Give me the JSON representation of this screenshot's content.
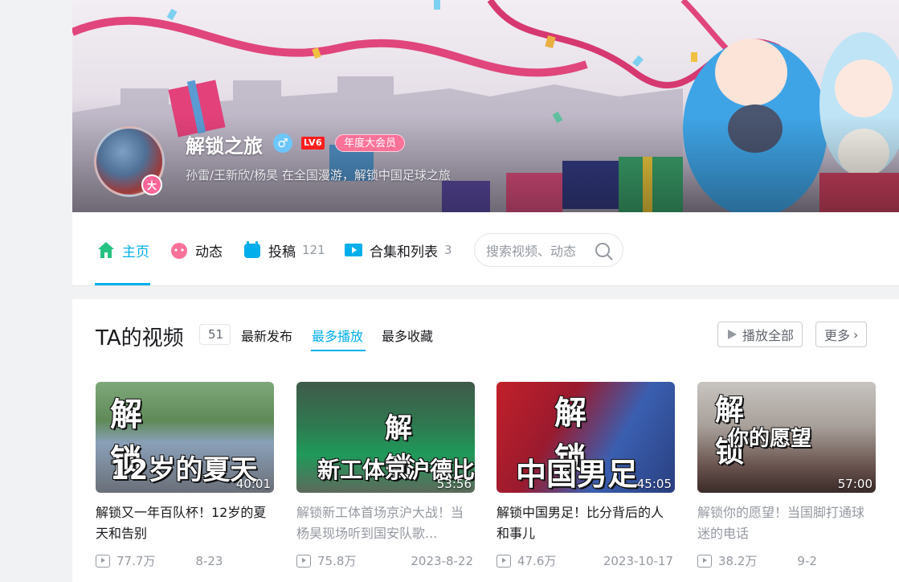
{
  "profile": {
    "name": "解锁之旅",
    "level": "LV6",
    "vip": "年度大会员",
    "avatar_badge": "大",
    "sign": "孙雷/王新欣/杨昊 在全国漫游，解锁中国足球之旅"
  },
  "nav": {
    "items": [
      {
        "label": "主页",
        "count": "",
        "icon": "home-icon"
      },
      {
        "label": "动态",
        "count": "",
        "icon": "dynamic-icon"
      },
      {
        "label": "投稿",
        "count": "121",
        "icon": "upload-icon"
      },
      {
        "label": "合集和列表",
        "count": "3",
        "icon": "collection-icon"
      }
    ],
    "search_placeholder": "搜索视频、动态"
  },
  "videos_section": {
    "title": "TA的视频",
    "count": "51",
    "sort_tabs": [
      "最新发布",
      "最多播放",
      "最多收藏"
    ],
    "active_sort": "最多播放",
    "play_all": "播放全部",
    "more": "更多"
  },
  "videos": [
    {
      "title": "解锁又一年百队杯！12岁的夏天和告别",
      "duration": "40:01",
      "views": "77.7万",
      "date": "8-23",
      "thumb_text_1": "解 锁",
      "thumb_text_2": "12岁的夏天"
    },
    {
      "title": "解锁新工体首场京沪大战！当杨昊现场听到国安队歌...",
      "duration": "53:56",
      "views": "75.8万",
      "date": "2023-8-22",
      "thumb_text_1": "解 锁",
      "thumb_text_2": "新工体京沪德比"
    },
    {
      "title": "解锁中国男足！比分背后的人和事儿",
      "duration": "45:05",
      "views": "47.6万",
      "date": "2023-10-17",
      "thumb_text_1": "解 锁",
      "thumb_text_2": "中国男足"
    },
    {
      "title": "解锁你的愿望！当国脚打通球迷的电话",
      "duration": "57:00",
      "views": "38.2万",
      "date": "9-2",
      "thumb_text_1": "解 锁",
      "thumb_text_2": "你的愿望"
    }
  ],
  "colors": {
    "accent": "#00aeec",
    "vip_pink": "#fb7299"
  }
}
